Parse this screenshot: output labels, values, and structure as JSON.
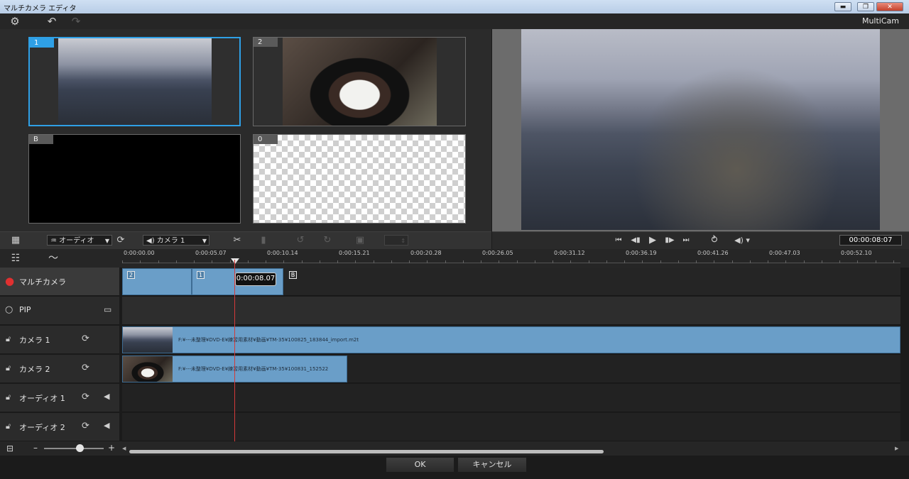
{
  "window": {
    "title": "マルチカメラ エディタ",
    "controls": [
      "minimize-icon",
      "restore-icon",
      "close-icon"
    ]
  },
  "toolbar": {
    "brand": "MultiCam",
    "icons": [
      "gear-icon",
      "undo-icon",
      "redo-icon"
    ]
  },
  "monitors": [
    {
      "label": "1",
      "content": "city-dusk",
      "active": true
    },
    {
      "label": "2",
      "content": "rice-bowl",
      "active": false
    },
    {
      "label": "B",
      "content": "black",
      "active": false
    },
    {
      "label": "0",
      "content": "transparent",
      "active": false
    }
  ],
  "left_controls": {
    "audio_dropdown": "オーディオ",
    "camera_dropdown": "カメラ 1",
    "icons": [
      "grid-icon",
      "sync-icon",
      "scissors-icon",
      "marker-icon",
      "rotate-left-icon",
      "rotate-right-icon",
      "fit-icon",
      "value-stepper"
    ]
  },
  "right_controls": {
    "timecode": "00:00:08:07",
    "icons": [
      "go-start-icon",
      "prev-frame-icon",
      "play-icon",
      "next-frame-icon",
      "go-end-icon",
      "loop-icon",
      "volume-icon"
    ]
  },
  "timeline": {
    "ruler_ticks": [
      "0:00:00.00",
      "0:00:05.07",
      "0:00:10.14",
      "0:00:15.21",
      "0:00:20.28",
      "0:00:26.05",
      "0:00:31.12",
      "0:00:36.19",
      "0:00:41.26",
      "0:00:47.03",
      "0:00:52.10"
    ],
    "playhead_time": "0:00:08.07",
    "tracks": [
      {
        "name": "マルチカメラ",
        "type": "multicam"
      },
      {
        "name": "PIP",
        "type": "pip"
      },
      {
        "name": "カメラ 1",
        "type": "camera"
      },
      {
        "name": "カメラ 2",
        "type": "camera"
      },
      {
        "name": "オーディオ 1",
        "type": "audio"
      },
      {
        "name": "オーディオ 2",
        "type": "audio"
      }
    ],
    "multicam_clips": [
      {
        "tag": "2"
      },
      {
        "tag": "1"
      },
      {
        "tag": "B"
      }
    ],
    "camera1_clip": "F:¥---未整理¥DVD-E¥練習用素材¥動画¥TM-35¥100825_183844_import.m2t",
    "camera2_clip": "F:¥---未整理¥DVD-E¥練習用素材¥動画¥TM-35¥100831_152522"
  },
  "zoom": {
    "minus": "–",
    "plus": "+",
    "level_fraction": 0.6
  },
  "buttons": {
    "ok": "OK",
    "cancel": "キャンセル"
  },
  "colors": {
    "accent": "#2fa0e6",
    "clip": "#6a9ec8",
    "playhead": "#d43a3a",
    "record": "#e03030"
  }
}
